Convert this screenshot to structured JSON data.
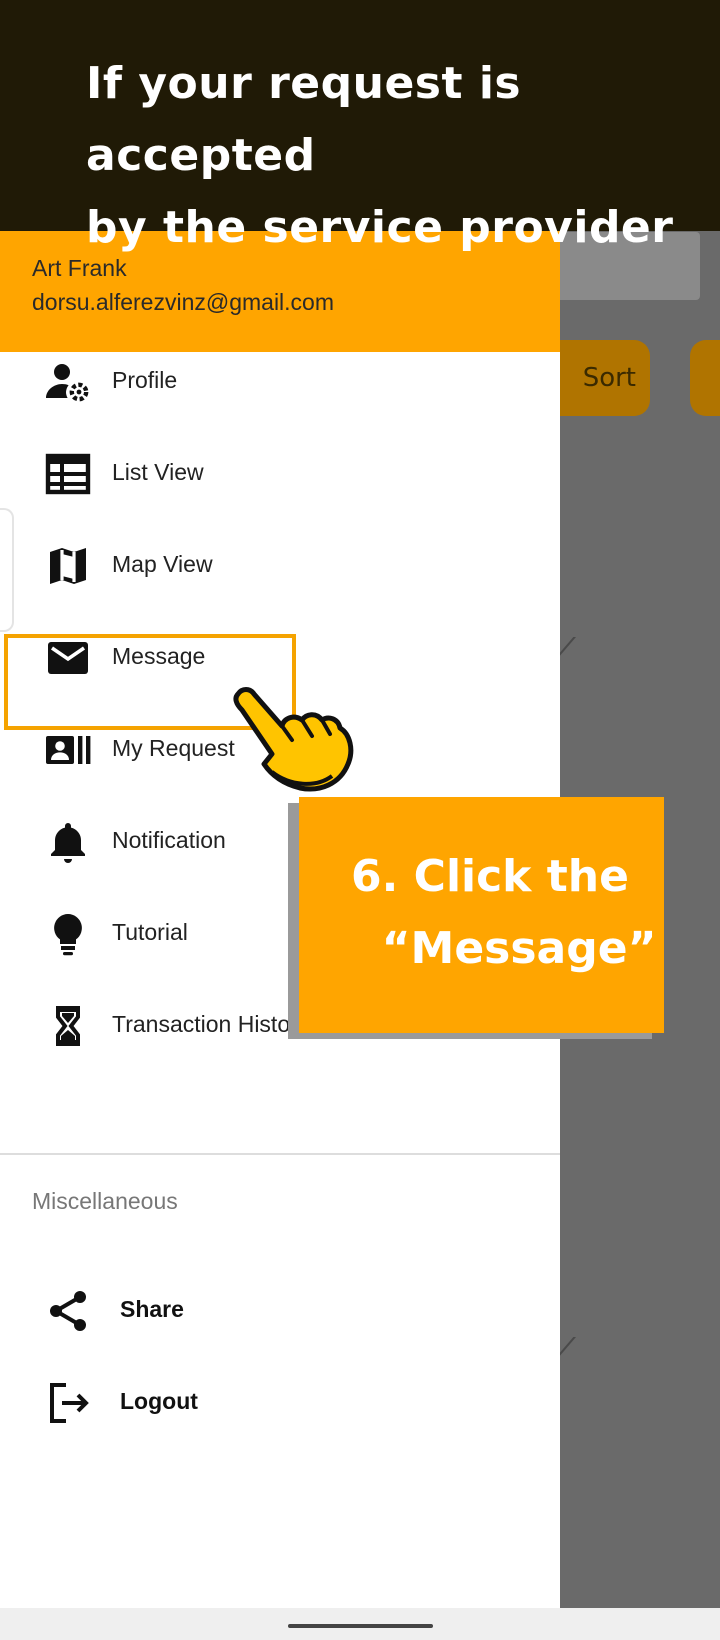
{
  "banner": {
    "line1": "If your request is accepted",
    "line2": "by the service provider"
  },
  "background": {
    "sort_label": "Sort"
  },
  "drawer": {
    "header": {
      "name": "Art Frank",
      "email": "dorsu.alferezvinz@gmail.com"
    },
    "items": [
      {
        "label": "Profile",
        "icon": "account-cog-icon"
      },
      {
        "label": "List View",
        "icon": "list-view-icon"
      },
      {
        "label": "Map View",
        "icon": "map-icon"
      },
      {
        "label": "Message",
        "icon": "mail-icon"
      },
      {
        "label": "My Request",
        "icon": "request-card-icon"
      },
      {
        "label": "Notification",
        "icon": "bell-icon"
      },
      {
        "label": "Tutorial",
        "icon": "lightbulb-icon"
      },
      {
        "label": "Transaction History",
        "icon": "hourglass-icon"
      }
    ],
    "misc_title": "Miscellaneous",
    "misc_items": [
      {
        "label": "Share",
        "icon": "share-icon"
      },
      {
        "label": "Logout",
        "icon": "logout-icon"
      }
    ]
  },
  "callout": {
    "text": "6. Click the\n  “Message”"
  },
  "colors": {
    "accent": "#ffa500",
    "banner_bg": "#201a06",
    "scrim": "#6a6a6a"
  }
}
